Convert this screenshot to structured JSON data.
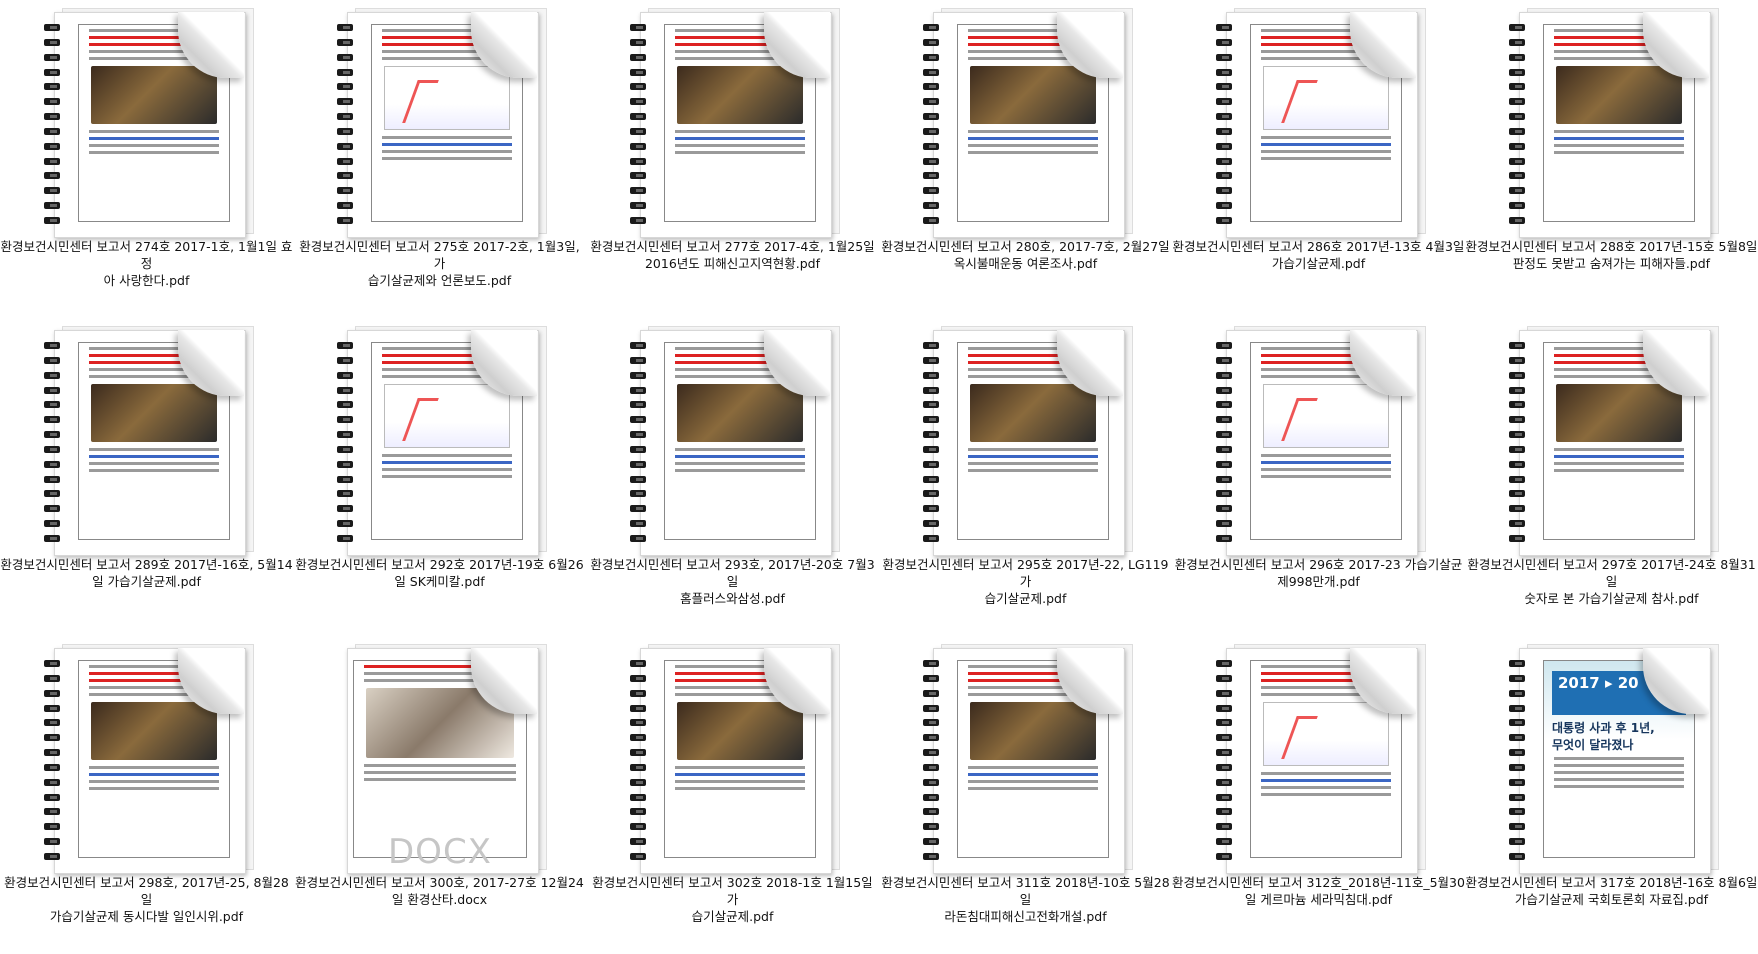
{
  "files": [
    {
      "name": "환경보건시민센터 보고서 274호 2017-1호, 1월1일 효정아 사랑한다.pdf",
      "line1": "환경보건시민센터 보고서 274호 2017-1호, 1월1일 효정",
      "line2": "아 사랑한다.pdf",
      "type": "pdf"
    },
    {
      "name": "환경보건시민센터 보고서 275호 2017-2호, 1월3일, 가습기살균제와 언론보도.pdf",
      "line1": "환경보건시민센터 보고서 275호 2017-2호, 1월3일, 가",
      "line2": "습기살균제와 언론보도.pdf",
      "type": "pdf"
    },
    {
      "name": "환경보건시민센터 보고서 277호 2017-4호, 1월25일 2016년도 피해신고지역현황.pdf",
      "line1": "환경보건시민센터 보고서 277호 2017-4호, 1월25일",
      "line2": "2016년도 피해신고지역현황.pdf",
      "type": "pdf"
    },
    {
      "name": "환경보건시민센터 보고서 280호, 2017-7호, 2월27일 옥시불매운동 여론조사.pdf",
      "line1": "환경보건시민센터 보고서 280호, 2017-7호, 2월27일",
      "line2": "옥시불매운동 여론조사.pdf",
      "type": "pdf"
    },
    {
      "name": "환경보건시민센터 보고서 286호 2017년-13호 4월3일 가습기살균제.pdf",
      "line1": "환경보건시민센터 보고서 286호 2017년-13호 4월3일",
      "line2": "가습기살균제.pdf",
      "type": "pdf"
    },
    {
      "name": "환경보건시민센터 보고서 288호 2017년-15호 5월8일 판정도 못받고 숨져가는 피해자들.pdf",
      "line1": "환경보건시민센터 보고서 288호 2017년-15호 5월8일",
      "line2": "판정도 못받고 숨져가는 피해자들.pdf",
      "type": "pdf"
    },
    {
      "name": "환경보건시민센터 보고서 289호 2017년-16호, 5월14일 가습기살균제.pdf",
      "line1": "환경보건시민센터 보고서 289호 2017년-16호, 5월14",
      "line2": "일 가습기살균제.pdf",
      "type": "pdf"
    },
    {
      "name": "환경보건시민센터 보고서 292호 2017년-19호 6월26일 SK케미칼.pdf",
      "line1": "환경보건시민센터 보고서 292호 2017년-19호 6월26",
      "line2": "일 SK케미칼.pdf",
      "type": "pdf"
    },
    {
      "name": "환경보건시민센터 보고서 293호, 2017년-20호 7월3일 홈플러스와삼성.pdf",
      "line1": "환경보건시민센터 보고서 293호, 2017년-20호 7월3일",
      "line2": "홈플러스와삼성.pdf",
      "type": "pdf"
    },
    {
      "name": "환경보건시민센터 보고서 295호 2017년-22, LG119 가습기살균제.pdf",
      "line1": "환경보건시민센터 보고서 295호 2017년-22, LG119 가",
      "line2": "습기살균제.pdf",
      "type": "pdf"
    },
    {
      "name": "환경보건시민센터 보고서 296호 2017-23 가습기살균제998만개.pdf",
      "line1": "환경보건시민센터 보고서 296호 2017-23 가습기살균",
      "line2": "제998만개.pdf",
      "type": "pdf"
    },
    {
      "name": "환경보건시민센터 보고서 297호 2017년-24호 8월31일 숫자로 본 가습기살균제 참사.pdf",
      "line1": "환경보건시민센터 보고서 297호 2017년-24호 8월31일",
      "line2": "숫자로 본 가습기살균제 참사.pdf",
      "type": "pdf"
    },
    {
      "name": "환경보건시민센터 보고서 298호, 2017년-25, 8월28일 가습기살균제 동시다발 일인시위.pdf",
      "line1": "환경보건시민센터 보고서 298호, 2017년-25, 8월28일",
      "line2": "가습기살균제 동시다발 일인시위.pdf",
      "type": "pdf"
    },
    {
      "name": "환경보건시민센터 보고서 300호, 2017-27호 12월24일 환경산타.docx",
      "line1": "환경보건시민센터 보고서 300호, 2017-27호 12월24",
      "line2": "일 환경산타.docx",
      "type": "docx"
    },
    {
      "name": "환경보건시민센터 보고서 302호 2018-1호 1월15일 가습기살균제.pdf",
      "line1": "환경보건시민센터 보고서 302호 2018-1호 1월15일 가",
      "line2": "습기살균제.pdf",
      "type": "pdf"
    },
    {
      "name": "환경보건시민센터 보고서 311호 2018년-10호 5월28일 라돈침대피해신고전화개설.pdf",
      "line1": "환경보건시민센터 보고서 311호 2018년-10호 5월28일",
      "line2": "라돈침대피해신고전화개설.pdf",
      "type": "pdf"
    },
    {
      "name": "환경보건시민센터 보고서 312호_2018년-11호_5월30일 게르마늄 세라믹침대.pdf",
      "line1": "환경보건시민센터 보고서 312호_2018년-11호_5월30",
      "line2": "일 게르마늄 세라믹침대.pdf",
      "type": "pdf"
    },
    {
      "name": "환경보건시민센터 보고서 317호 2018년-16호 8월6일 가습기살균제 국회토론회 자료집.pdf",
      "line1": "환경보건시민센터 보고서 317호 2018년-16호 8월6일",
      "line2": "가습기살균제 국회토론회 자료집.pdf",
      "type": "pdf-cover"
    }
  ],
  "docx_badge": "DOCX",
  "cover_text": {
    "year": "2017 ▸ 20",
    "headline1": "대통령 사과 후 1년,",
    "headline2": "무엇이 달라졌나"
  }
}
